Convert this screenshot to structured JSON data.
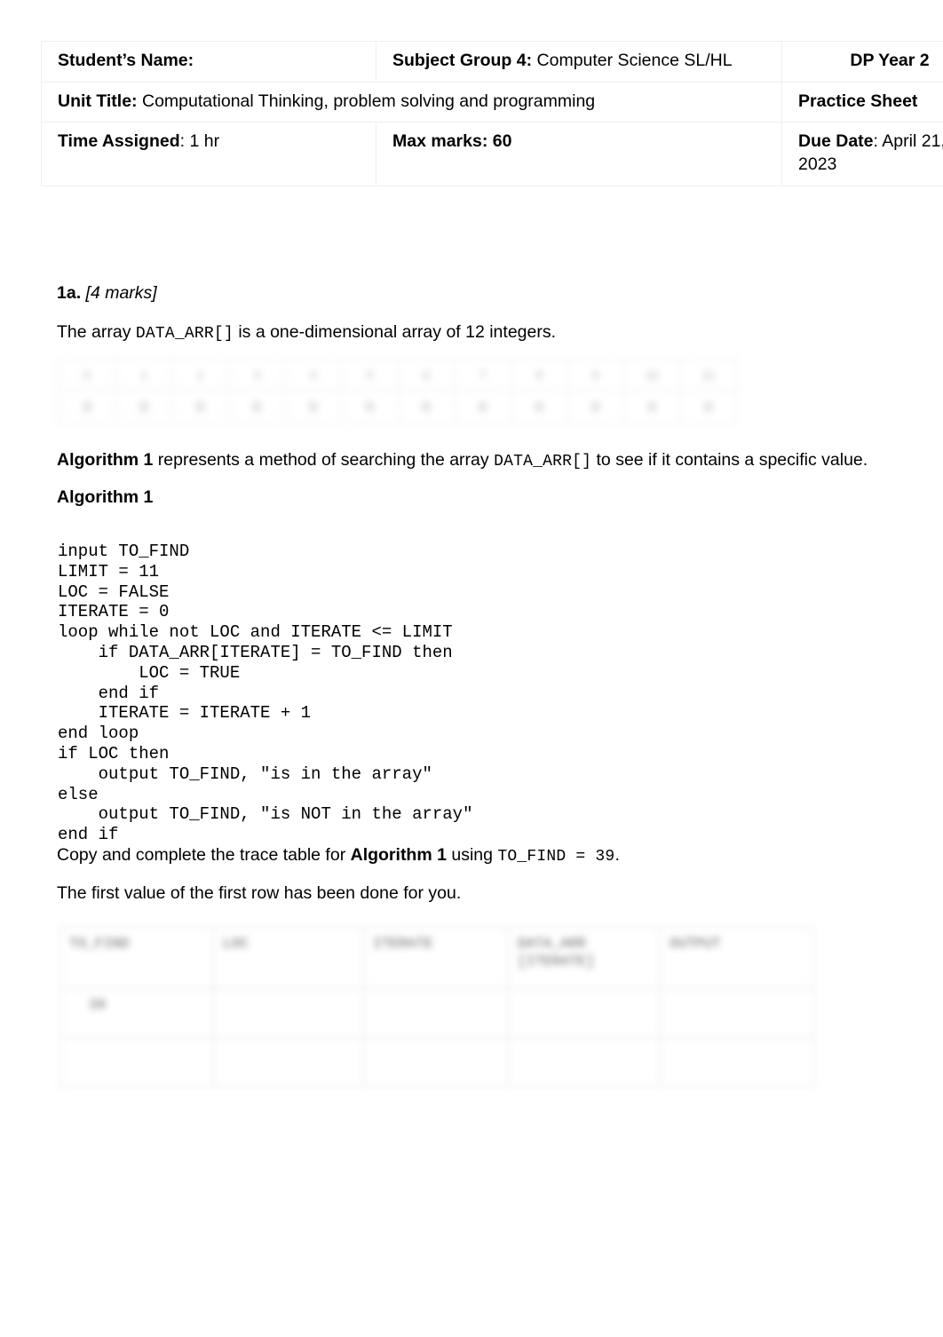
{
  "header_table": {
    "row1": {
      "students_name_label": "Student’s Name:",
      "subject_group_label": "Subject Group 4:",
      "subject_group_value": " Computer Science SL/HL",
      "year_label": "DP Year 2"
    },
    "row2": {
      "unit_title_label": "Unit Title:",
      "unit_title_value": "  Computational Thinking, problem solving and programming",
      "sheet_type": "Practice Sheet"
    },
    "row3": {
      "time_assigned_label": "Time Assigned",
      "time_assigned_value": ": 1 hr",
      "max_marks": "Max marks: 60",
      "due_date_label": "Due Date",
      "due_date_value": ": April 21, 2023"
    }
  },
  "question": {
    "number": "1a.",
    "marks": " [4 marks]",
    "intro_part1": "The array ",
    "intro_mono": "DATA_ARR[]",
    "intro_part2": " is a one-dimensional array of 12 integers.",
    "algo_ref_bold": "Algorithm 1",
    "algo_ref_part1": " represents a method of searching the array ",
    "algo_ref_mono": "DATA_ARR[]",
    "algo_ref_part2": " to see if it contains a specific value.",
    "algorithm_heading": "Algorithm 1",
    "trace_instruction_part1": "Copy and complete the trace table for ",
    "trace_instruction_bold": "Algorithm 1",
    "trace_instruction_part2": " using ",
    "trace_instruction_mono": "TO_FIND = 39",
    "trace_instruction_part3": ".",
    "first_value_note": "The first value of the first row has been done for you."
  },
  "algorithm_code": "input TO_FIND\nLIMIT = 11\nLOC = FALSE\nITERATE = 0\nloop while not LOC and ITERATE <= LIMIT\n    if DATA_ARR[ITERATE] = TO_FIND then\n        LOC = TRUE\n    end if\n    ITERATE = ITERATE + 1\nend loop\nif LOC then\n    output TO_FIND, \"is in the array\"\nelse\n    output TO_FIND, \"is NOT in the array\"\nend if",
  "array_table": {
    "redacted": true,
    "columns": 12,
    "index_row": [
      "0",
      "1",
      "2",
      "3",
      "4",
      "5",
      "6",
      "7",
      "8",
      "9",
      "10",
      "11"
    ],
    "value_row": [
      "0",
      "0",
      "0",
      "0",
      "0",
      "0",
      "0",
      "0",
      "0",
      "0",
      "0",
      "0"
    ]
  },
  "trace_table": {
    "redacted": true,
    "headers": [
      "TO_FIND",
      "LOC",
      "ITERATE",
      "DATA_ARR [ITERATE]",
      "OUTPUT"
    ],
    "rows": [
      [
        "39",
        "",
        "",
        "",
        ""
      ],
      [
        "",
        "",
        "",
        "",
        ""
      ]
    ]
  },
  "colors": {
    "page_background": "#ffffff",
    "text": "#000000",
    "table_border": "#f0f0f0",
    "redacted_border": "#dcdcdc"
  }
}
